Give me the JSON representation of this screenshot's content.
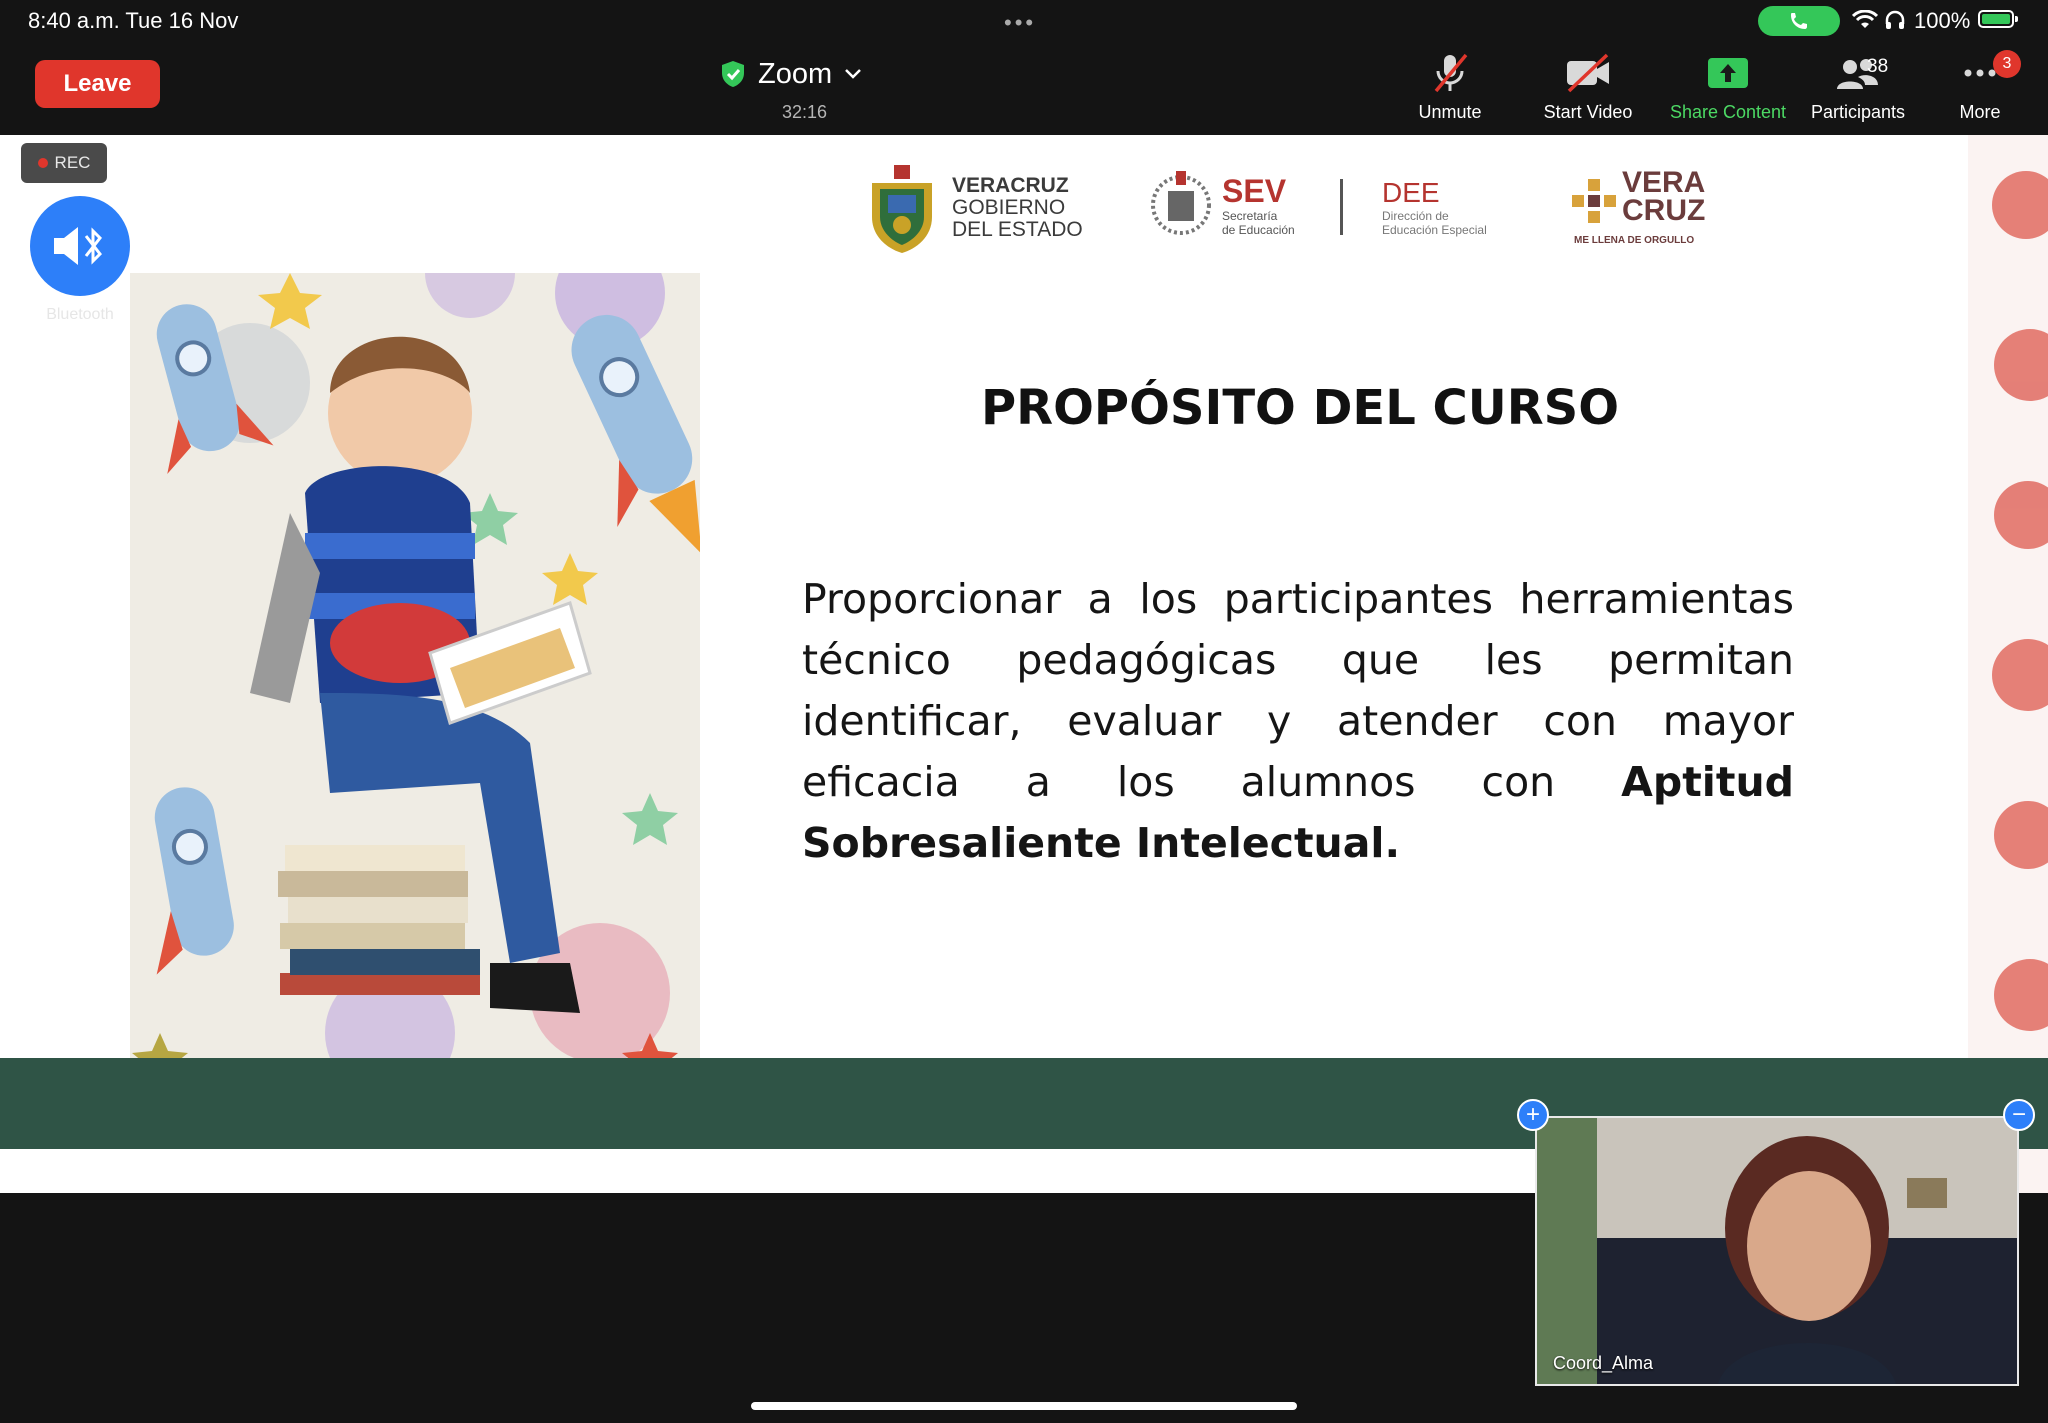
{
  "status_bar": {
    "time_date": "8:40 a.m.   Tue 16 Nov",
    "battery": "100%",
    "icons": [
      "phone-icon",
      "wifi-icon",
      "headphones-icon",
      "battery-charging-icon"
    ]
  },
  "toolbar": {
    "leave_label": "Leave",
    "meeting_name": "Zoom",
    "timer": "32:16",
    "unmute_label": "Unmute",
    "start_video_label": "Start Video",
    "share_label": "Share Content",
    "participants_label": "Participants",
    "participants_count": "38",
    "more_label": "More",
    "more_badge": "3"
  },
  "recording": {
    "label": "REC"
  },
  "audio": {
    "label": "Bluetooth"
  },
  "slide": {
    "logos": {
      "veracruz_line1": "VERACRUZ",
      "veracruz_line2": "GOBIERNO",
      "veracruz_line3": "DEL ESTADO",
      "sev": "SEV",
      "sev_sub1": "Secretaría",
      "sev_sub2": "de Educación",
      "dee": "DEE",
      "dee_sub1": "Dirección de",
      "dee_sub2": "Educación Especial",
      "vc_line1": "VERA",
      "vc_line2": "CRUZ",
      "vc_sub": "ME LLENA DE ORGULLO"
    },
    "title": "PROPÓSITO DEL CURSO",
    "body_plain": "Proporcionar a los participantes herramientas técnico pedagógicas que les permitan identificar, evaluar y atender con mayor eficacia a los alumnos con ",
    "body_bold": "Aptitud Sobresaliente Intelectual."
  },
  "video": {
    "participant_name": "Coord_Alma"
  },
  "colors": {
    "leave": "#e0362c",
    "share_green": "#4cd964",
    "accent_blue": "#2d7ff9",
    "slide_band": "#2f5446",
    "slide_red": "#b5342f"
  }
}
